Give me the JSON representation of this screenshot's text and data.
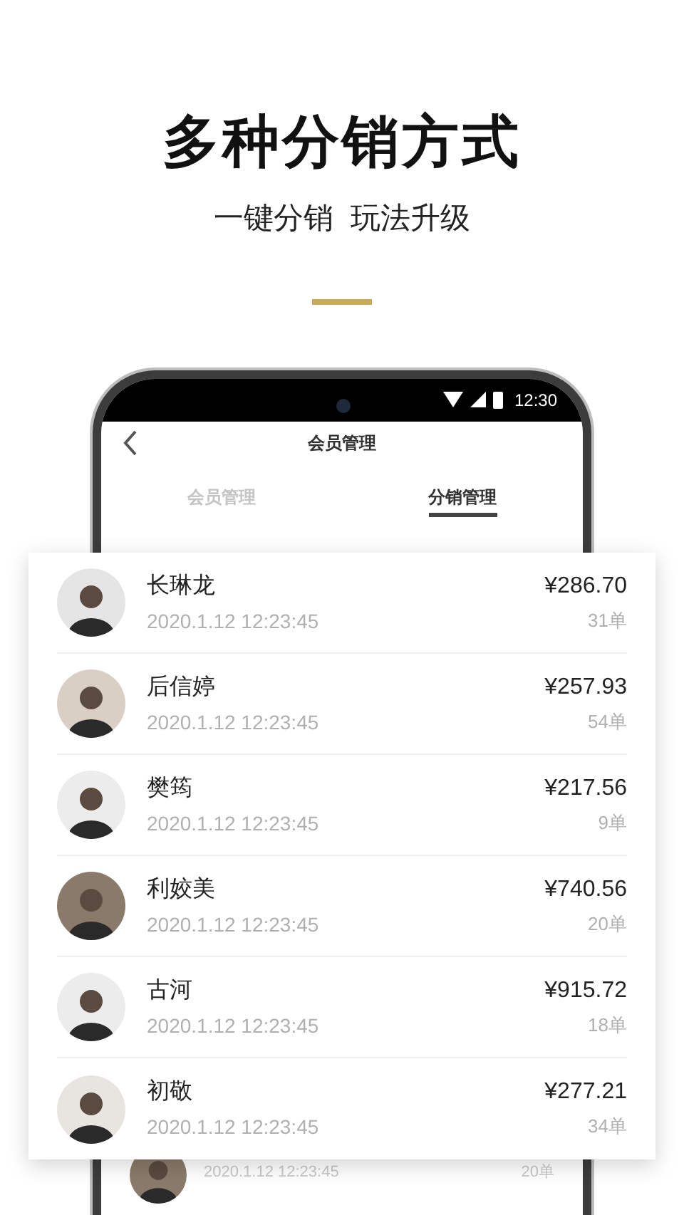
{
  "headline": "多种分销方式",
  "subheadline": "一键分销  玩法升级",
  "phone": {
    "status_bar": {
      "time": "12:30"
    },
    "nav": {
      "title": "会员管理"
    },
    "tabs": [
      {
        "label": "会员管理",
        "selected": false
      },
      {
        "label": "分销管理",
        "selected": true
      }
    ],
    "partial_row": {
      "date": "2020.1.12 12:23:45",
      "orders": "20单"
    }
  },
  "members": [
    {
      "name": "长琳龙",
      "date": "2020.1.12 12:23:45",
      "amount": "¥286.70",
      "orders": "31单"
    },
    {
      "name": "后信婷",
      "date": "2020.1.12 12:23:45",
      "amount": "¥257.93",
      "orders": "54单"
    },
    {
      "name": "樊筠",
      "date": "2020.1.12 12:23:45",
      "amount": "¥217.56",
      "orders": "9单"
    },
    {
      "name": "利姣美",
      "date": "2020.1.12 12:23:45",
      "amount": "¥740.56",
      "orders": "20单"
    },
    {
      "name": "古河",
      "date": "2020.1.12 12:23:45",
      "amount": "¥915.72",
      "orders": "18单"
    },
    {
      "name": "初敬",
      "date": "2020.1.12 12:23:45",
      "amount": "¥277.21",
      "orders": "34单"
    }
  ]
}
